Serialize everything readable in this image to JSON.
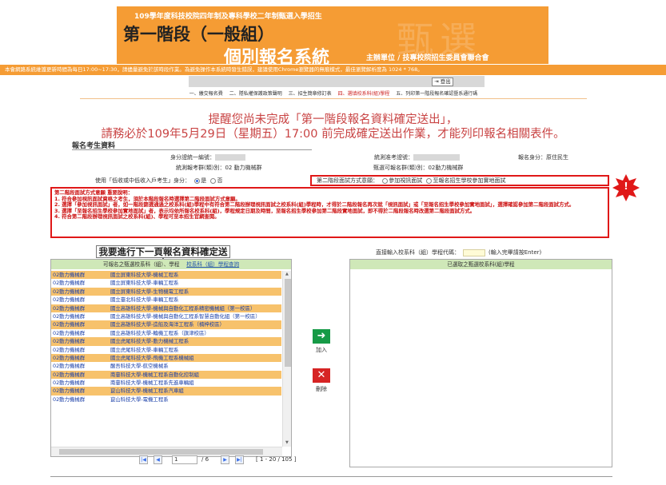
{
  "header": {
    "subtitle": "109學年度科技校院四年制及專科學校二年制甄選入學招生",
    "stage": "第一階段（一般組）",
    "system": "個別報名系統",
    "org": "主辦單位 / 技專校院招生委員會聯合會",
    "deco": "甄選"
  },
  "notice": "本會網路系統維護更新時間為每日17:00~17:30，請儘量避免於該時段作業。為避免操作本系統時發生錯誤，建議使用Chrome瀏覽器的無痕模式，最佳瀏覽解析度為 1024 * 768。",
  "logout_label": "登出",
  "menu": {
    "items": [
      "一、繳交報名費",
      "二、隱私權保護政策聲明",
      "三、招生簡章修訂表",
      "四、選填校系科(組)學程",
      "五、列印第一階段報名確認暨系通行碼"
    ]
  },
  "reminder": {
    "line1": "提醒您尚未完成「第一階段報名資料確定送出」，",
    "line2": "請務必於109年5月29日（星期五）17:00 前完成確定送出作業，才能列印報名相關表件。"
  },
  "section_title": "報名考生資料",
  "info": {
    "id_label": "身分證統一編號：",
    "exam_id_label": "統測准考證號：",
    "identity_label": "報名身分：",
    "identity_value": "原住民生",
    "group_label": "統測報考群(類)別：",
    "group_value": "02 動力機械群",
    "apply_group_label": "甄選可報名群(類)別：",
    "apply_group_value": "02動力機械群",
    "lowincome_label": "使用「低收或中低收入戶考生」身分：",
    "yes": "是",
    "no": "否",
    "method_label": "第二階段面試方式意願：",
    "method_opt1": "參加視訊面試",
    "method_opt2": "至報名招生學校參加實地面試"
  },
  "description": {
    "title": "第二階段面試方式意願 重要說明：",
    "items": [
      "1. 符合參加視訊面試資格之考生，須於本階段報名時選擇第二階段面試方式意願。",
      "2. 選擇「參加視訊面試」者，如一階段篩選通過之校系科(組)學程中有符合第二階段辦理視訊面試之校系科(組)學程時，才得於二階段報名再次就「視訊面試」或「至報名招生學校參加實地面試」，選擇確認參加第二階段面試方式。",
      "3. 選擇「至報名招生學校參加實地面試」者，表示均依所報名校系科(組)，學程規定日期及時間，至報名招生學校參加第二階段實地面試，即不得於二階段報名時改選第二階段面試方式。",
      "4. 符合第二階段辦理視訊面試之校系科(組)、學程可至本招生官網查閱。"
    ]
  },
  "next_title": "我要進行下一頁報名資料確定送出",
  "direct_input": {
    "label": "直接輸入校系科（組）學程代碼：",
    "hint": "(輸入完畢請按Enter)"
  },
  "left_panel": {
    "head_text": "可報名之甄選校系科（組）、學程",
    "head_link": "校系科（組）學程查詢",
    "rows": [
      {
        "group": "02動力機械群",
        "dept": "國立屏東科技大學-機械工程系"
      },
      {
        "group": "02動力機械群",
        "dept": "國立屏東科技大學-車輛工程系"
      },
      {
        "group": "02動力機械群",
        "dept": "國立屏東科技大學-生物機電工程系"
      },
      {
        "group": "02動力機械群",
        "dept": "國立臺北科技大學-車輛工程系"
      },
      {
        "group": "02動力機械群",
        "dept": "國立高雄科技大學-機械與自動化工程系精密機械組（第一校區）"
      },
      {
        "group": "02動力機械群",
        "dept": "國立高雄科技大學-機械與自動化工程系智慧自動化組（第一校區）"
      },
      {
        "group": "02動力機械群",
        "dept": "國立高雄科技大學-造船及海洋工程系（楠梓校區）"
      },
      {
        "group": "02動力機械群",
        "dept": "國立高雄科技大學-輪機工程系（旗津校區）"
      },
      {
        "group": "02動力機械群",
        "dept": "國立虎尾科技大學-動力機械工程系"
      },
      {
        "group": "02動力機械群",
        "dept": "國立虎尾科技大學-車輛工程系"
      },
      {
        "group": "02動力機械群",
        "dept": "國立虎尾科技大學-飛機工程系機械組"
      },
      {
        "group": "02動力機械群",
        "dept": "醒吾科技大學-航空機械系"
      },
      {
        "group": "02動力機械群",
        "dept": "南臺科技大學-機械工程系自動化控制組"
      },
      {
        "group": "02動力機械群",
        "dept": "南臺科技大學-機械工程系先進車輛組"
      },
      {
        "group": "02動力機械群",
        "dept": "崑山科技大學-機械工程系汽車組"
      },
      {
        "group": "02動力機械群",
        "dept": "崑山科技大學-電機工程系"
      }
    ]
  },
  "pager": {
    "page": "1",
    "total": "/ 6",
    "range": "[ 1 - 20 / 105 ]"
  },
  "add_label": "加入",
  "delete_label": "刪除",
  "right_panel": {
    "head_text": "已選取之甄選校系科(組)學程"
  },
  "colors": {
    "header_orange": "#f59c34",
    "alert_red": "#e01818",
    "row_highlight": "#f7c26c",
    "add_green": "#169a46",
    "delete_red": "#d62424"
  }
}
